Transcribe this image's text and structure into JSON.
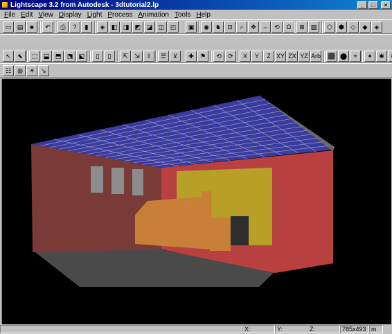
{
  "window": {
    "title": "Lightscape 3.2 from Autodesk - 3dtutorial2.lp",
    "min_glyph": "_",
    "max_glyph": "□",
    "close_glyph": "×"
  },
  "menu": [
    {
      "pre": "",
      "key": "F",
      "post": "ile"
    },
    {
      "pre": "",
      "key": "E",
      "post": "dit"
    },
    {
      "pre": "",
      "key": "V",
      "post": "iew"
    },
    {
      "pre": "",
      "key": "D",
      "post": "isplay"
    },
    {
      "pre": "",
      "key": "L",
      "post": "ight"
    },
    {
      "pre": "",
      "key": "P",
      "post": "rocess"
    },
    {
      "pre": "",
      "key": "A",
      "post": "nimation"
    },
    {
      "pre": "",
      "key": "T",
      "post": "ools"
    },
    {
      "pre": "",
      "key": "H",
      "post": "elp"
    }
  ],
  "toolbar1": {
    "buttons": [
      {
        "name": "new-file-icon",
        "glyph": "▭"
      },
      {
        "name": "open-file-icon",
        "glyph": "▤"
      },
      {
        "name": "save-file-icon",
        "glyph": "■"
      },
      {
        "name": "undo-icon",
        "glyph": "↶"
      },
      {
        "name": "print-icon",
        "glyph": "⎙"
      },
      {
        "name": "help-icon",
        "glyph": "?"
      },
      {
        "name": "context-help-icon",
        "glyph": "▮"
      },
      {
        "name": "camera-icon",
        "glyph": "◈"
      },
      {
        "name": "view-cube-1-icon",
        "glyph": "◧"
      },
      {
        "name": "view-cube-2-icon",
        "glyph": "◨"
      },
      {
        "name": "view-cube-3-icon",
        "glyph": "◩"
      },
      {
        "name": "view-cube-4-icon",
        "glyph": "◪"
      },
      {
        "name": "view-cube-5-icon",
        "glyph": "◫"
      },
      {
        "name": "view-cube-6-icon",
        "glyph": "◰"
      },
      {
        "name": "render-view-icon",
        "glyph": "▣"
      },
      {
        "name": "eye-icon",
        "glyph": "◉"
      },
      {
        "name": "walk-icon",
        "glyph": "♞"
      },
      {
        "name": "zoom-window-icon",
        "glyph": "⊡"
      },
      {
        "name": "zoom-icon",
        "glyph": "⌕"
      },
      {
        "name": "pan-icon",
        "glyph": "✥"
      },
      {
        "name": "dolly-icon",
        "glyph": "⇔"
      },
      {
        "name": "orbit-icon",
        "glyph": "⟲"
      },
      {
        "name": "roll-icon",
        "glyph": "Ω"
      },
      {
        "name": "zoom-extents-icon",
        "glyph": "⊞"
      },
      {
        "name": "previous-view-icon",
        "glyph": "▧"
      },
      {
        "name": "wireframe-icon",
        "glyph": "⬡"
      },
      {
        "name": "hidden-line-icon",
        "glyph": "⬢"
      },
      {
        "name": "flat-shade-icon",
        "glyph": "◇"
      },
      {
        "name": "smooth-shade-icon",
        "glyph": "◆"
      },
      {
        "name": "textured-shade-icon",
        "glyph": "◈"
      }
    ]
  },
  "toolbar2": {
    "buttons": [
      {
        "name": "select-arrow-icon",
        "glyph": "↖"
      },
      {
        "name": "select-object-icon",
        "glyph": "⬉"
      },
      {
        "name": "select-window-icon",
        "glyph": "⬚"
      },
      {
        "name": "select-surface-icon",
        "glyph": "⬓"
      },
      {
        "name": "select-layer-icon",
        "glyph": "⬒"
      },
      {
        "name": "select-material-icon",
        "glyph": "⬔"
      },
      {
        "name": "select-block-icon",
        "glyph": "⬕"
      },
      {
        "name": "page-1-icon",
        "glyph": "▯"
      },
      {
        "name": "page-2-icon",
        "glyph": "▯"
      },
      {
        "name": "pointer-tool-icon",
        "glyph": "⇱"
      },
      {
        "name": "select-tool-2-icon",
        "glyph": "⇲"
      },
      {
        "name": "select-tool-3-icon",
        "glyph": "⇳"
      },
      {
        "name": "properties-icon",
        "glyph": "☰"
      },
      {
        "name": "select-filter-icon",
        "glyph": "⊻"
      },
      {
        "name": "add-light-icon",
        "glyph": "✚"
      },
      {
        "name": "light-select-icon",
        "glyph": "⚑"
      },
      {
        "name": "rotate-left-icon",
        "glyph": "⟲"
      },
      {
        "name": "rotate-right-icon",
        "glyph": "⟳"
      },
      {
        "name": "axis-x-label",
        "glyph": "X"
      },
      {
        "name": "axis-y-label",
        "glyph": "Y"
      },
      {
        "name": "axis-z-label",
        "glyph": "Z"
      },
      {
        "name": "plane-xy-label",
        "glyph": "XY"
      },
      {
        "name": "plane-zx-label",
        "glyph": "ZX"
      },
      {
        "name": "plane-yz-label",
        "glyph": "YZ"
      },
      {
        "name": "align-label",
        "glyph": "Arb"
      },
      {
        "name": "snap-icon",
        "glyph": "⬛"
      },
      {
        "name": "snap-2-icon",
        "glyph": "⬤"
      },
      {
        "name": "measure-icon",
        "glyph": "⌖"
      },
      {
        "name": "figure-1-icon",
        "glyph": "✶"
      },
      {
        "name": "figure-2-icon",
        "glyph": "✱"
      },
      {
        "name": "figure-3-icon",
        "glyph": "✻"
      }
    ]
  },
  "toolbar3": {
    "buttons": [
      {
        "name": "layers-icon",
        "glyph": "☷"
      },
      {
        "name": "globe-icon",
        "glyph": "◍"
      },
      {
        "name": "light-bulb-icon",
        "glyph": "☀"
      },
      {
        "name": "light-pointer-icon",
        "glyph": "↘"
      }
    ]
  },
  "statusbar": {
    "x_label": "X:",
    "y_label": "Y:",
    "z_label": "Z:",
    "resolution": "785x493",
    "units": "m"
  },
  "scene": {
    "background": "#000000",
    "ceiling_color": "#3b3b9e",
    "ceiling_grid_color": "#a8a8d8",
    "left_wall_color": "#7a3a38",
    "back_wall_color": "#b84040",
    "right_wall_color": "#c03838",
    "floor_color": "#4a4a4a",
    "panel_color": "#b8a028",
    "furniture_color": "#c88038",
    "window_color": "#8c8c8c"
  }
}
